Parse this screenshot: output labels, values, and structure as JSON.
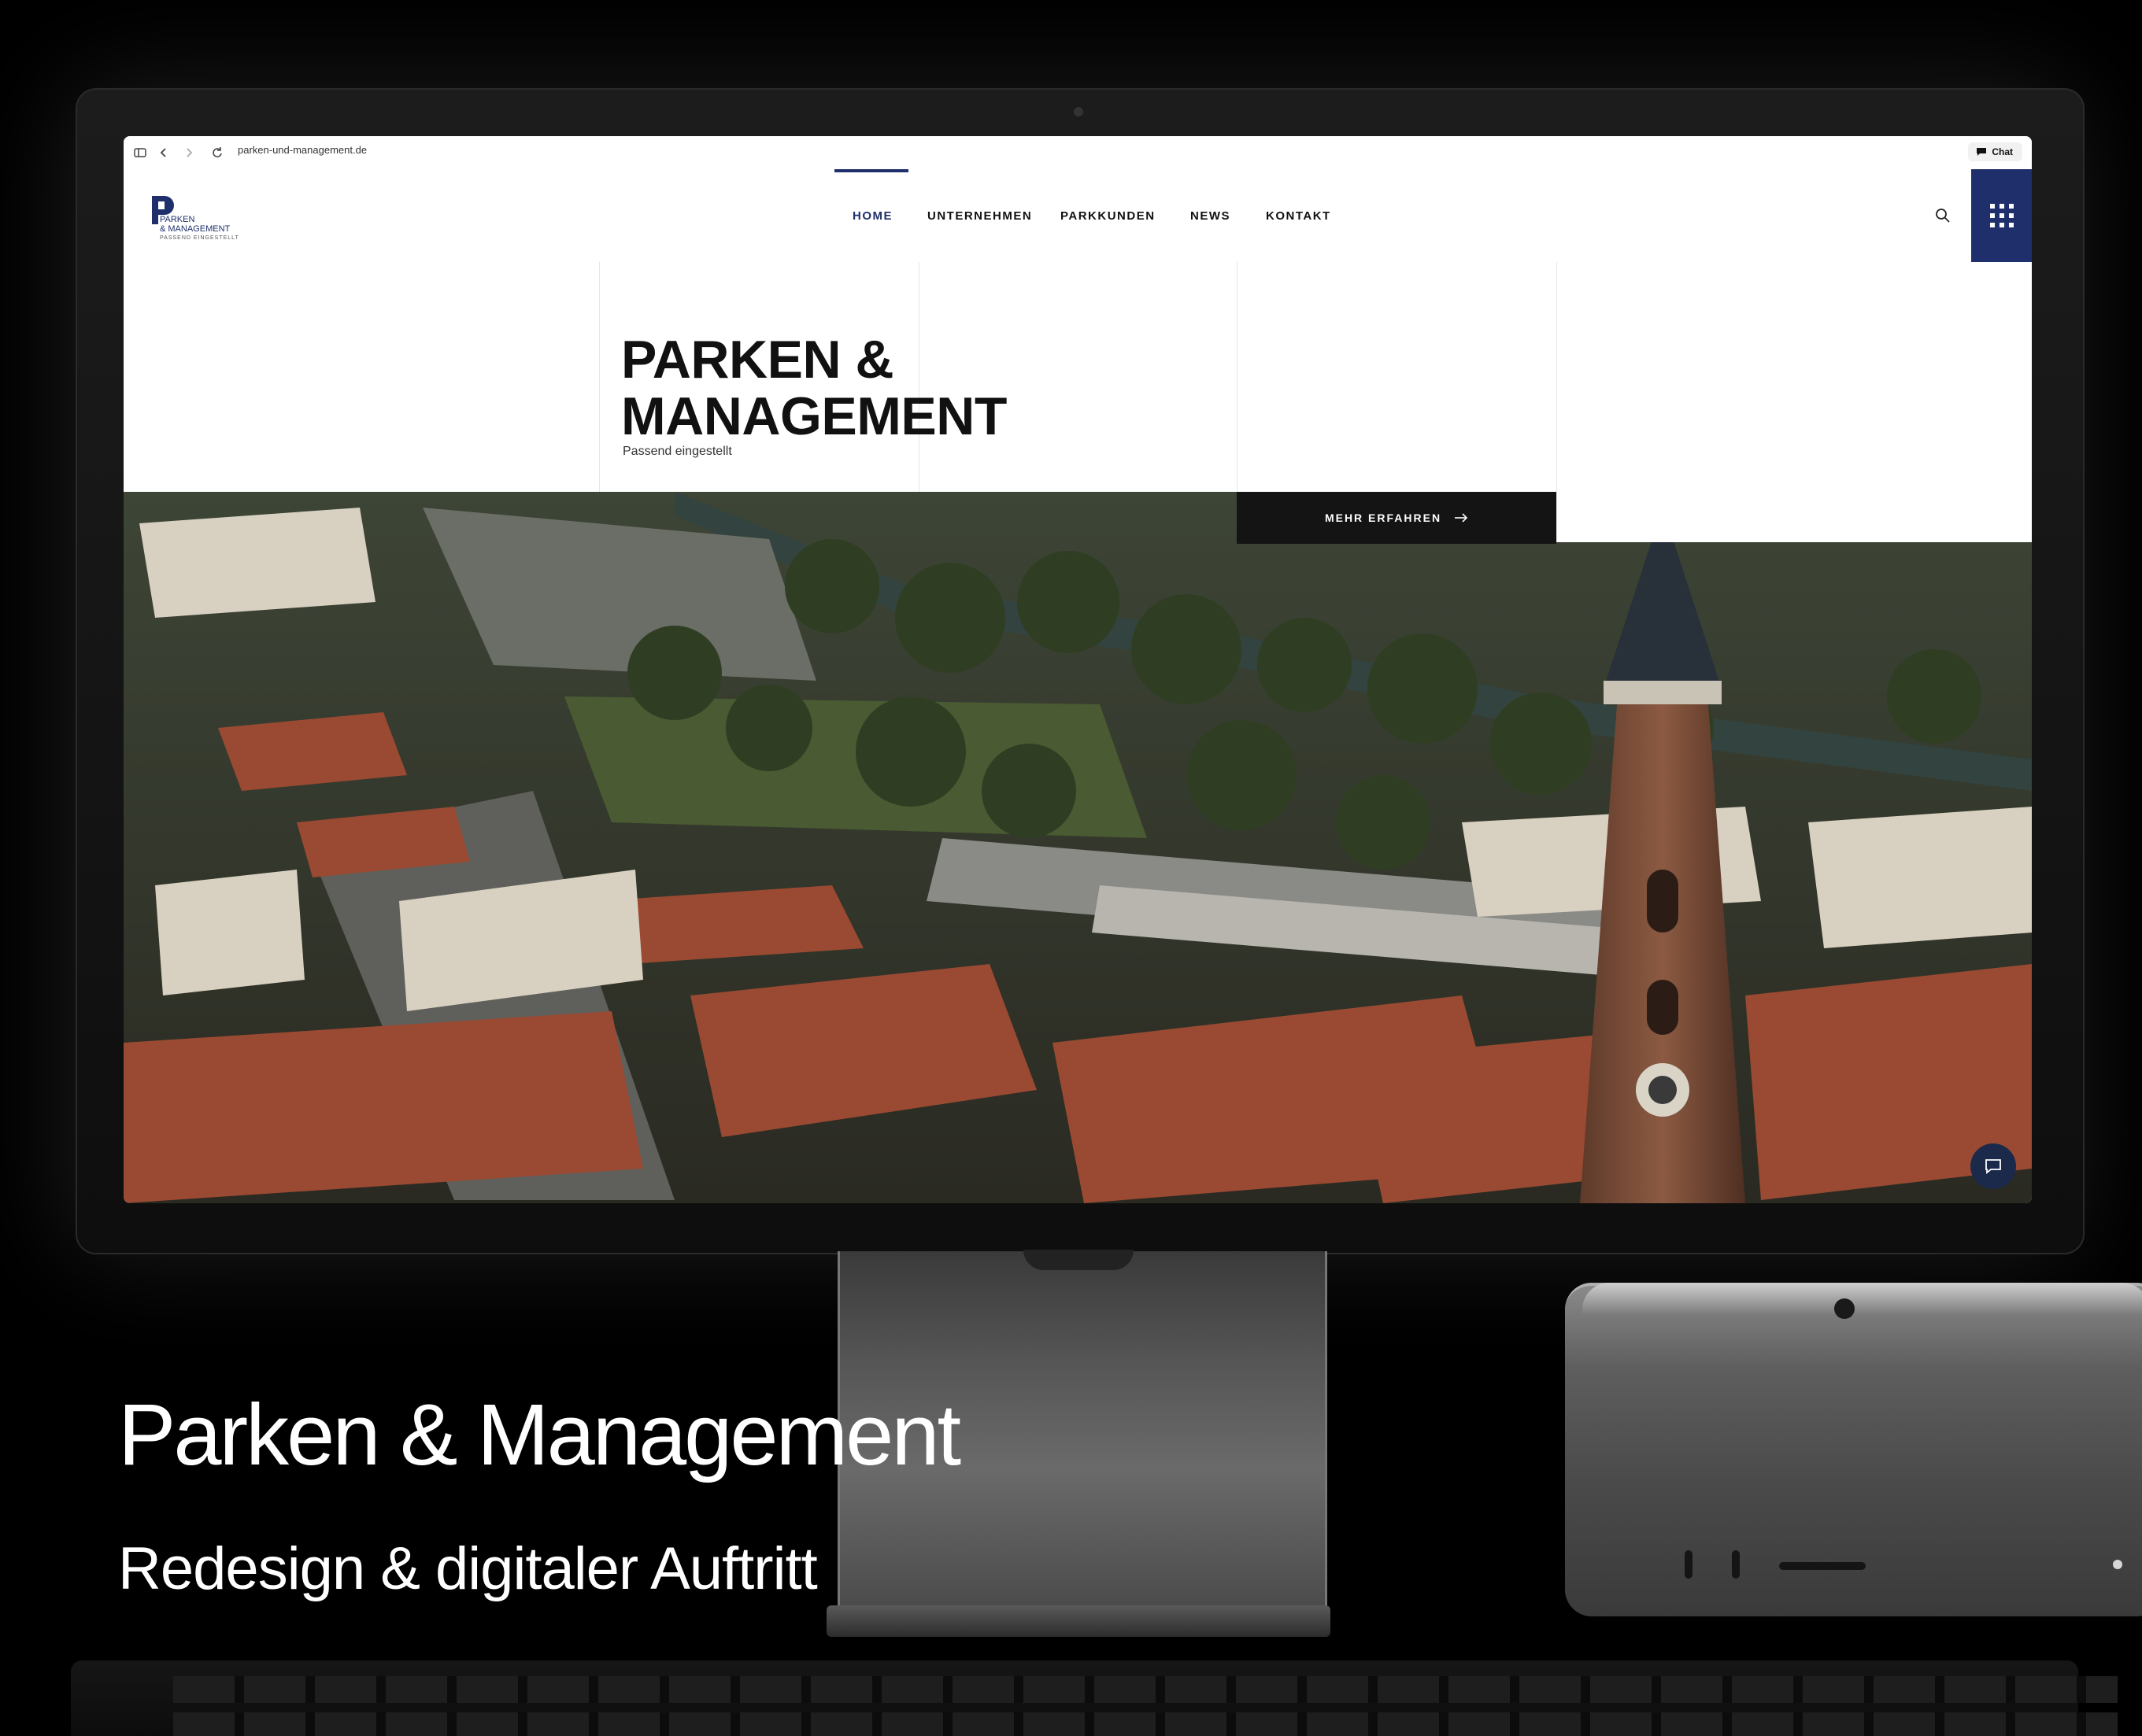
{
  "browser": {
    "url": "parken-und-management.de",
    "chat_label": "Chat"
  },
  "site": {
    "logo": {
      "line1": "PARKEN",
      "line2": "& MANAGEMENT",
      "tagline": "PASSEND EINGESTELLT"
    },
    "nav": [
      {
        "label": "HOME",
        "active": true
      },
      {
        "label": "UNTERNEHMEN",
        "active": false
      },
      {
        "label": "PARKKUNDEN",
        "active": false
      },
      {
        "label": "NEWS",
        "active": false
      },
      {
        "label": "KONTAKT",
        "active": false
      }
    ],
    "hero": {
      "title_line1": "PARKEN &",
      "title_line2": "MANAGEMENT",
      "subtitle": "Passend eingestellt",
      "cta_label": "MEHR ERFAHREN"
    },
    "accent_color": "#1f2f6b"
  },
  "caption": {
    "title": "Parken & Management",
    "subtitle": "Redesign & digitaler Auftritt"
  }
}
